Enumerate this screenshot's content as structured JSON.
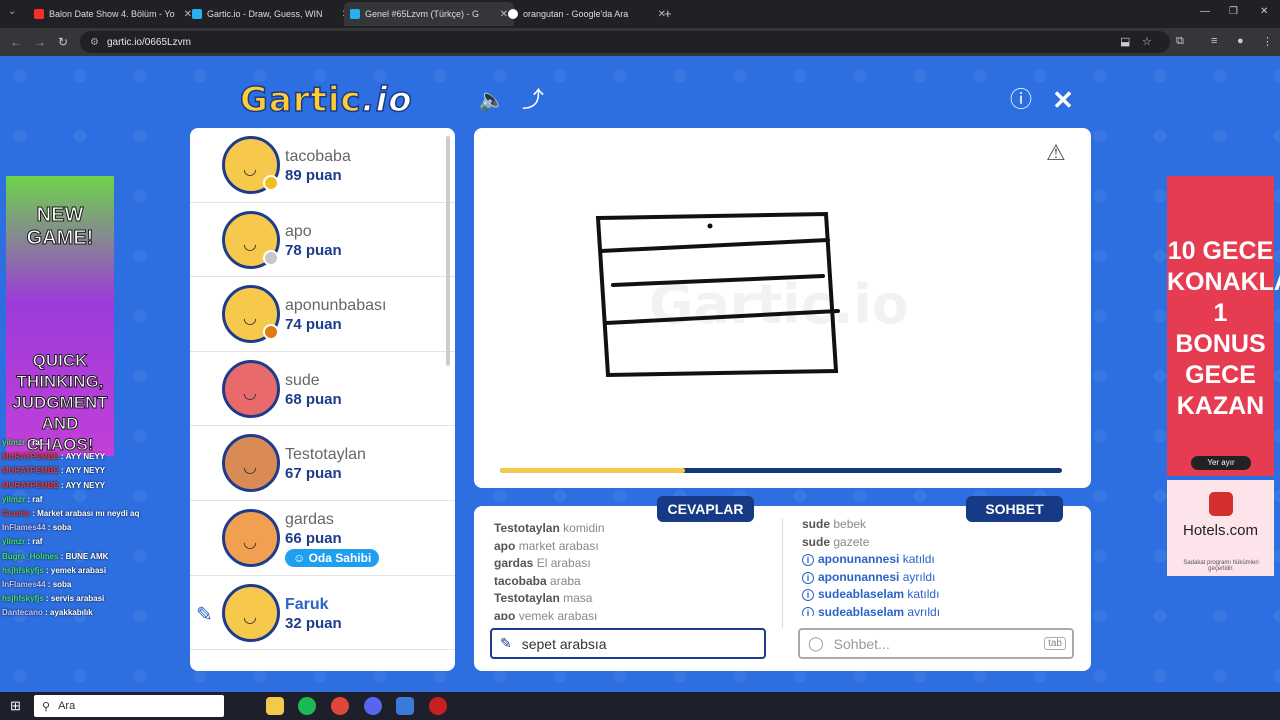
{
  "browser": {
    "tabs": [
      {
        "title": "Balon Date Show 4. Bölüm - Yo",
        "color": "#ff2a2a"
      },
      {
        "title": "Gartic.io - Draw, Guess, WIN",
        "color": "#2ab0f0"
      },
      {
        "title": "Genel #65Lzvm (Türkçe) - G",
        "color": "#2ab0f0"
      },
      {
        "title": "orangutan - Google'da Ara",
        "color": "#ffffff"
      }
    ],
    "url": "gartic.io/0665Lzvm"
  },
  "header": {
    "logo": "Gartic",
    "logo_suffix": ".io"
  },
  "players": [
    {
      "name": "tacobaba",
      "score": "89 puan",
      "dot": "#f0c020"
    },
    {
      "name": "apo",
      "score": "78 puan",
      "dot": "#c8c8c8"
    },
    {
      "name": "aponunbabası",
      "score": "74 puan",
      "dot": "#e07a12"
    },
    {
      "name": "sude",
      "score": "68 puan",
      "dot": ""
    },
    {
      "name": "Testotaylan",
      "score": "67 puan",
      "dot": ""
    },
    {
      "name": "gardas",
      "score": "66 puan",
      "dot": "",
      "badge": "Oda Sahibi"
    },
    {
      "name": "Faruk",
      "score": "32 puan",
      "dot": "",
      "drawing": true
    }
  ],
  "timer": {
    "progress": 0.33
  },
  "answers": {
    "header": "CEVAPLAR",
    "rows": [
      {
        "user": "Testotaylan",
        "text": "komidin"
      },
      {
        "user": "apo",
        "text": "market arabası"
      },
      {
        "user": "gardas",
        "text": "El arabası"
      },
      {
        "user": "tacobaba",
        "text": "araba"
      },
      {
        "user": "Testotaylan",
        "text": "masa"
      },
      {
        "user": "apo",
        "text": "yemek arabası"
      }
    ],
    "input_value": "sepet arabsıa"
  },
  "chat": {
    "header": "SOHBET",
    "rows": [
      {
        "user": "sude",
        "text": "bebek"
      },
      {
        "user": "sude",
        "text": "gazete"
      }
    ],
    "events": [
      {
        "user": "aponunannesi",
        "event": "katıldı"
      },
      {
        "user": "aponunannesi",
        "event": "ayrıldı"
      },
      {
        "user": "sudeablaselam",
        "event": "katıldı"
      },
      {
        "user": "sudeablaselam",
        "event": "ayrıldı"
      }
    ],
    "placeholder": "Sohbet...",
    "tab_hint": "tab"
  },
  "ads": {
    "left_top": "NEW GAME!",
    "left_bottom": "QUICK THINKING, JUDGMENT AND CHAOS!",
    "right_text": "10 GECE KONAKLA 1 BONUS GECE KAZAN",
    "right_button": "Yer ayır",
    "hotels_name": "Hotels.com",
    "hotels_small": "Sadakat programı hükümleri geçerlidir."
  },
  "overlay_chat": [
    {
      "user": "yilmzr",
      "text": "raf",
      "cls": "u"
    },
    {
      "user": "MURATPEMBE",
      "text": "AYY NEYY",
      "cls": "u2"
    },
    {
      "user": "MURATPEMBE",
      "text": "AYY NEYY",
      "cls": "u2"
    },
    {
      "user": "MURATPEMBE",
      "text": "AYY NEYY",
      "cls": "u2"
    },
    {
      "user": "yilmzr",
      "text": "raf",
      "cls": "u"
    },
    {
      "user": "Granite",
      "text": "Market arabası mı neydi aq",
      "cls": "u2"
    },
    {
      "user": "InFlames44",
      "text": "soba",
      "cls": "u3"
    },
    {
      "user": "yilmzr",
      "text": "raf",
      "cls": "u"
    },
    {
      "user": "Bugra_Holmes",
      "text": "BUNE AMK",
      "cls": "u"
    },
    {
      "user": "hsjhfskyfjs",
      "text": "yemek arabasi",
      "cls": "u"
    },
    {
      "user": "InFlames44",
      "text": "soba",
      "cls": "u3"
    },
    {
      "user": "hsjhfskyfjs",
      "text": "servis arabasi",
      "cls": "u"
    },
    {
      "user": "Dantecano",
      "text": "ayakkabılık",
      "cls": "u3"
    }
  ],
  "taskbar": {
    "search": "Ara"
  }
}
